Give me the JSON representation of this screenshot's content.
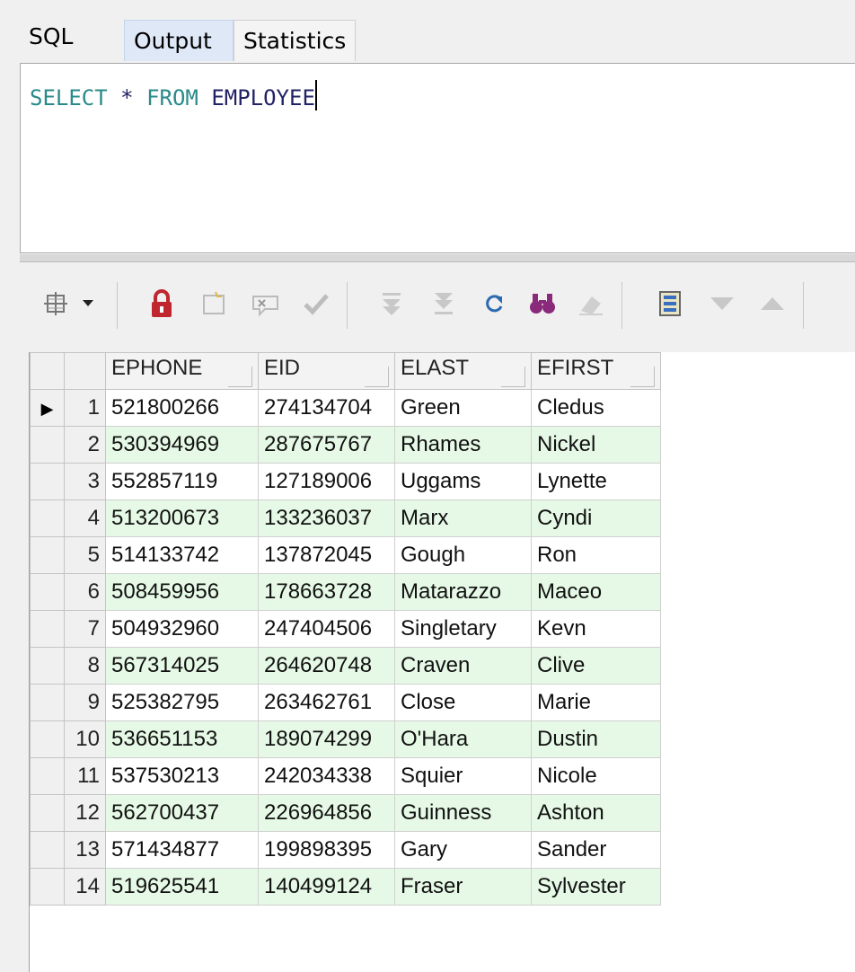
{
  "tabs": {
    "sql": "SQL",
    "output": "Output",
    "statistics": "Statistics"
  },
  "editor": {
    "kw_select": "SELECT",
    "star": "*",
    "kw_from": "FROM",
    "table": "EMPLOYEE"
  },
  "toolbar_icons": [
    "grid-options-icon",
    "dropdown-arrow-icon",
    "lock-icon",
    "new-record-icon",
    "cancel-edit-icon",
    "post-edit-icon",
    "first-record-icon",
    "last-record-icon",
    "refresh-icon",
    "find-icon",
    "clear-icon",
    "export-icon",
    "down-arrow-icon",
    "up-arrow-icon"
  ],
  "grid": {
    "columns": [
      "EPHONE",
      "EID",
      "ELAST",
      "EFIRST"
    ],
    "current_row_indicator": "▶",
    "rows": [
      {
        "n": "1",
        "ephone": "521800266",
        "eid": "274134704",
        "elast": "Green",
        "efirst": "Cledus"
      },
      {
        "n": "2",
        "ephone": "530394969",
        "eid": "287675767",
        "elast": "Rhames",
        "efirst": "Nickel"
      },
      {
        "n": "3",
        "ephone": "552857119",
        "eid": "127189006",
        "elast": "Uggams",
        "efirst": "Lynette"
      },
      {
        "n": "4",
        "ephone": "513200673",
        "eid": "133236037",
        "elast": "Marx",
        "efirst": "Cyndi"
      },
      {
        "n": "5",
        "ephone": "514133742",
        "eid": "137872045",
        "elast": "Gough",
        "efirst": "Ron"
      },
      {
        "n": "6",
        "ephone": "508459956",
        "eid": "178663728",
        "elast": "Matarazzo",
        "efirst": "Maceo"
      },
      {
        "n": "7",
        "ephone": "504932960",
        "eid": "247404506",
        "elast": "Singletary",
        "efirst": "Kevn"
      },
      {
        "n": "8",
        "ephone": "567314025",
        "eid": "264620748",
        "elast": "Craven",
        "efirst": "Clive"
      },
      {
        "n": "9",
        "ephone": "525382795",
        "eid": "263462761",
        "elast": "Close",
        "efirst": "Marie"
      },
      {
        "n": "10",
        "ephone": "536651153",
        "eid": "189074299",
        "elast": "O'Hara",
        "efirst": "Dustin"
      },
      {
        "n": "11",
        "ephone": "537530213",
        "eid": "242034338",
        "elast": "Squier",
        "efirst": "Nicole"
      },
      {
        "n": "12",
        "ephone": "562700437",
        "eid": "226964856",
        "elast": "Guinness",
        "efirst": "Ashton"
      },
      {
        "n": "13",
        "ephone": "571434877",
        "eid": "199898395",
        "elast": "Gary",
        "efirst": "Sander"
      },
      {
        "n": "14",
        "ephone": "519625541",
        "eid": "140499124",
        "elast": "Fraser",
        "efirst": "Sylvester"
      }
    ]
  },
  "colors": {
    "alt_row": "#e6f9e6",
    "keyword": "#2a8a8a",
    "lock_red": "#c0262d",
    "find_purple": "#8a2a7a"
  }
}
